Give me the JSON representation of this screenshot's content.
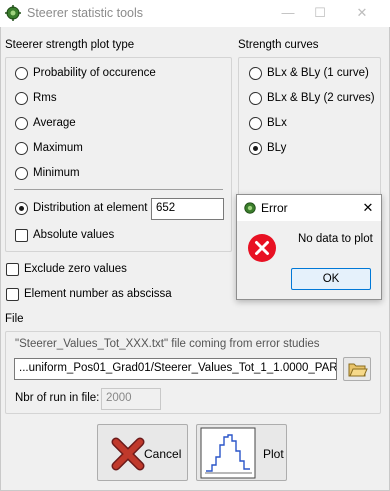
{
  "window": {
    "title": "Steerer statistic tools"
  },
  "plot_type": {
    "label": "Steerer strength plot type",
    "options": [
      "Probability of occurence",
      "Rms",
      "Average",
      "Maximum",
      "Minimum"
    ],
    "distribution_label": "Distribution at element",
    "distribution_value": "652",
    "absolute_values_label": "Absolute values"
  },
  "strength_curves": {
    "label": "Strength curves",
    "options": [
      "BLx & BLy (1 curve)",
      "BLx & BLy (2 curves)",
      "BLx",
      "BLy"
    ],
    "selected": "BLy"
  },
  "checkboxes": {
    "exclude_zero": "Exclude zero values",
    "element_abscissa": "Element number as abscissa"
  },
  "file": {
    "label": "File",
    "description": "\"Steerer_Values_Tot_XXX.txt\" file coming from error studies",
    "path": "...uniform_Pos01_Grad01/Steerer_Values_Tot_1_1.0000_PAR.txt",
    "nbr_run_label": "Nbr of run in file:",
    "nbr_run_value": "2000"
  },
  "buttons": {
    "cancel": "Cancel",
    "plot": "Plot"
  },
  "error_dialog": {
    "title": "Error",
    "message": "No data to plot",
    "ok": "OK"
  },
  "colors": {
    "error_red": "#e81123",
    "accent": "#0078d7"
  }
}
